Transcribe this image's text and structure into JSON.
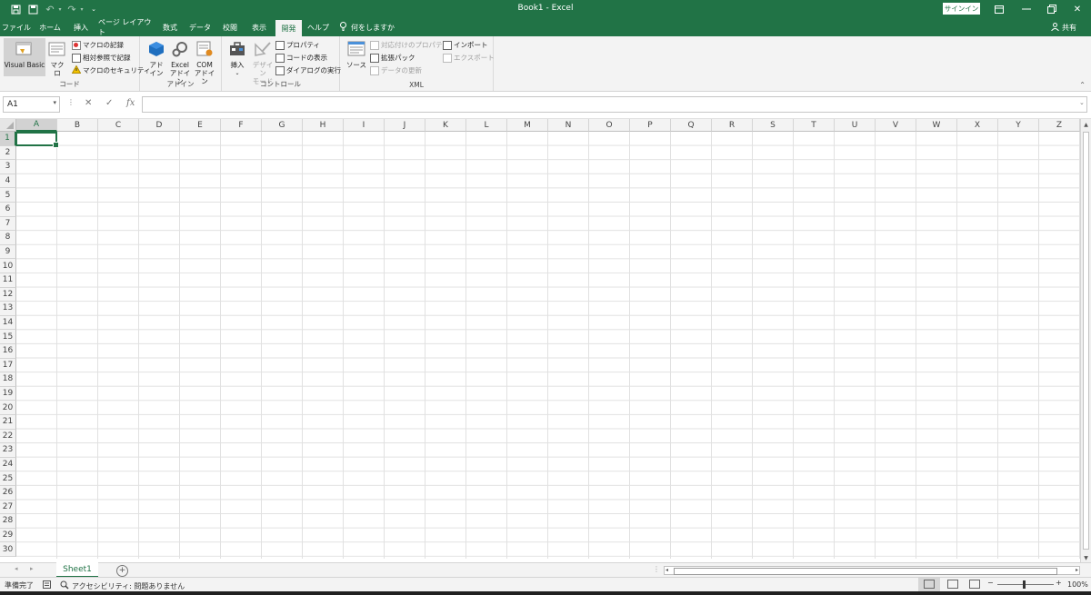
{
  "titlebar": {
    "title": "Book1  -  Excel",
    "signin": "サインイン",
    "save_icon": "save-icon",
    "accent": "#217346"
  },
  "tabs": [
    {
      "label": "ファイル"
    },
    {
      "label": "ホーム"
    },
    {
      "label": "挿入"
    },
    {
      "label": "ページ レイアウト"
    },
    {
      "label": "数式"
    },
    {
      "label": "データ"
    },
    {
      "label": "校閲"
    },
    {
      "label": "表示"
    },
    {
      "label": "開発",
      "active": true
    },
    {
      "label": "ヘルプ"
    },
    {
      "label": "何をしますか"
    }
  ],
  "share": "共有",
  "ribbon": {
    "code": {
      "label": "コード",
      "visual_basic": "Visual Basic",
      "macro": "マクロ",
      "record_macro": "マクロの記録",
      "relative_ref": "相対参照で記録",
      "macro_security": "マクロのセキュリティ"
    },
    "addins": {
      "label": "アドイン",
      "addin_line1": "アド",
      "addin_line2": "イン",
      "excel_line1": "Excel",
      "excel_line2": "アドイン",
      "com_line1": "COM",
      "com_line2": "アドイン"
    },
    "controls": {
      "label": "コントロール",
      "insert": "挿入",
      "design_line1": "デザイン",
      "design_line2": "モード",
      "properties": "プロパティ",
      "view_code": "コードの表示",
      "run_dialog": "ダイアログの実行"
    },
    "xml": {
      "label": "XML",
      "source": "ソース",
      "map_properties": "対応付けのプロパティ",
      "expansion_packs": "拡張パック",
      "refresh_data": "データの更新",
      "import": "インポート",
      "export": "エクスポート"
    }
  },
  "formula_bar": {
    "name_box": "A1",
    "cancel_glyph": "✕",
    "enter_glyph": "✓",
    "fx": "fx",
    "formula": ""
  },
  "grid": {
    "columns": [
      "A",
      "B",
      "C",
      "D",
      "E",
      "F",
      "G",
      "H",
      "I",
      "J",
      "K",
      "L",
      "M",
      "N",
      "O",
      "P",
      "Q",
      "R",
      "S",
      "T",
      "U",
      "V",
      "W",
      "X",
      "Y",
      "Z"
    ],
    "rows": [
      "1",
      "2",
      "3",
      "4",
      "5",
      "6",
      "7",
      "8",
      "9",
      "10",
      "11",
      "12",
      "13",
      "14",
      "15",
      "16",
      "17",
      "18",
      "19",
      "20",
      "21",
      "22",
      "23",
      "24",
      "25",
      "26",
      "27",
      "28",
      "29",
      "30"
    ],
    "selected_cell": "A1"
  },
  "sheets": [
    {
      "name": "Sheet1",
      "active": true
    }
  ],
  "status": {
    "ready": "準備完了",
    "accessibility": "アクセシビリティ: 問題ありません",
    "zoom": "100%",
    "zoom_minus": "−",
    "zoom_plus": "+"
  }
}
